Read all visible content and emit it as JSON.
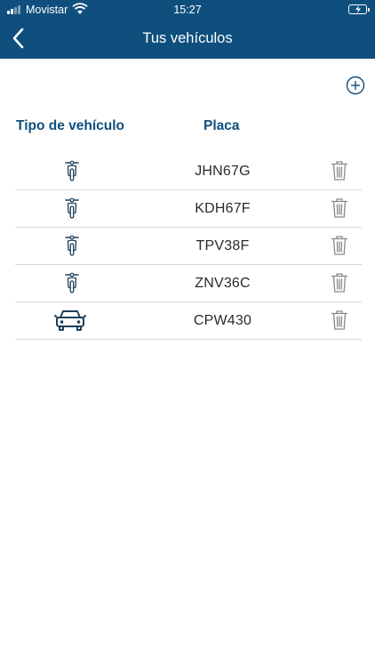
{
  "status_bar": {
    "carrier": "Movistar",
    "time": "15:27"
  },
  "header": {
    "title": "Tus vehículos",
    "background_color": "#0f4f7d"
  },
  "table": {
    "columns": [
      "Tipo de vehículo",
      "Placa"
    ],
    "rows": [
      {
        "vehicle_type": "motorcycle-icon",
        "plate": "JHN67G"
      },
      {
        "vehicle_type": "motorcycle-icon",
        "plate": "KDH67F"
      },
      {
        "vehicle_type": "motorcycle-icon",
        "plate": "TPV38F"
      },
      {
        "vehicle_type": "motorcycle-icon",
        "plate": "ZNV36C"
      },
      {
        "vehicle_type": "car-icon",
        "plate": "CPW430"
      }
    ]
  },
  "icons": {
    "back": "chevron-left-icon",
    "add": "add-circle-icon",
    "delete": "trash-icon"
  }
}
